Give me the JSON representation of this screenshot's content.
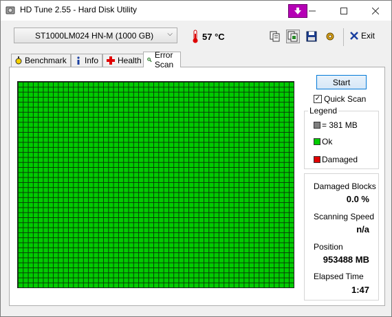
{
  "window": {
    "title": "HD Tune 2.55 - Hard Disk Utility"
  },
  "toolbar": {
    "drive": "ST1000LM024 HN-M (1000 GB)",
    "temperature": "57 °C",
    "exit_label": "Exit"
  },
  "tabs": [
    {
      "label": "Benchmark",
      "icon": "stopwatch-icon"
    },
    {
      "label": "Info",
      "icon": "info-icon"
    },
    {
      "label": "Health",
      "icon": "health-cross-icon"
    },
    {
      "label": "Error Scan",
      "icon": "magnifier-icon"
    }
  ],
  "scan": {
    "start_label": "Start",
    "quick_scan_label": "Quick Scan",
    "quick_scan_checked": true,
    "block_status": "Ok"
  },
  "legend": {
    "title": "Legend",
    "items": [
      {
        "label": "= 381 MB",
        "color": "#7f7f7f"
      },
      {
        "label": "Ok",
        "color": "#00cc00"
      },
      {
        "label": "Damaged",
        "color": "#e00000"
      }
    ]
  },
  "stats": {
    "damaged_blocks_label": "Damaged Blocks",
    "damaged_blocks_value": "0.0 %",
    "scanning_speed_label": "Scanning Speed",
    "scanning_speed_value": "n/a",
    "position_label": "Position",
    "position_value": "953488 MB",
    "elapsed_label": "Elapsed Time",
    "elapsed_value": "1:47"
  }
}
